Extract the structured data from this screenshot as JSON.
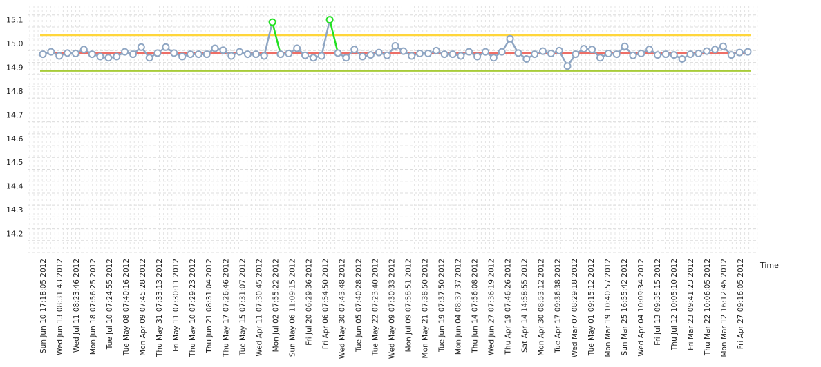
{
  "chart_data": {
    "type": "line",
    "title": "",
    "xlabel": "Time",
    "ylabel": "",
    "ylim": [
      14.12,
      15.16
    ],
    "yticks": [
      14.2,
      14.3,
      14.4,
      14.5,
      14.6,
      14.7,
      14.8,
      14.9,
      15.0,
      15.1
    ],
    "grid": true,
    "x_tick_labels": [
      "Sun Jun 10 17:18:05 2012",
      "Wed Jun 13 08:31:43 2012",
      "Wed Jul 11 08:23:46 2012",
      "Mon Jun 18 07:56:25 2012",
      "Tue Jul 10 07:24:55 2012",
      "Tue May 08 07:40:16 2012",
      "Mon Apr 09 07:45:28 2012",
      "Thu May 31 07:33:13 2012",
      "Fri May 11 07:30:11 2012",
      "Thu May 10 07:29:23 2012",
      "Thu Jun 21 08:31:04 2012",
      "Thu May 17 07:26:46 2012",
      "Tue May 15 07:31:07 2012",
      "Wed Apr 11 07:30:45 2012",
      "Mon Jul 02 07:55:22 2012",
      "Sun May 06 11:09:15 2012",
      "Fri Jul 20 06:29:36 2012",
      "Fri Apr 06 07:54:50 2012",
      "Wed May 30 07:43:48 2012",
      "Tue Jun 05 07:40:28 2012",
      "Tue May 22 07:23:40 2012",
      "Wed May 09 07:30:33 2012",
      "Mon Jul 09 07:58:51 2012",
      "Mon May 21 07:38:50 2012",
      "Tue Jun 19 07:37:50 2012",
      "Mon Jun 04 08:37:37 2012",
      "Thu Jun 14 07:56:08 2012",
      "Wed Jun 27 07:36:19 2012",
      "Thu Apr 19 07:46:26 2012",
      "Sat Apr 14 14:58:55 2012",
      "Mon Apr 30 08:53:12 2012",
      "Tue Apr 17 09:36:38 2012",
      "Wed Mar 07 08:29:18 2012",
      "Tue May 01 09:15:12 2012",
      "Mon Mar 19 10:40:57 2012",
      "Sun Mar 25 16:55:42 2012",
      "Wed Apr 04 10:09:34 2012",
      "Fri Jul 13 09:35:15 2012",
      "Thu Jul 12 10:05:10 2012",
      "Fri Mar 23 09:41:23 2012",
      "Thu Mar 22 10:06:05 2012",
      "Mon Mar 12 16:12:45 2012",
      "Fri Apr 27 09:16:05 2012"
    ],
    "series": [
      {
        "values": [
          14.955,
          14.965,
          14.948,
          14.96,
          14.958,
          14.975,
          14.955,
          14.945,
          14.94,
          14.945,
          14.965,
          14.955,
          14.985,
          14.94,
          14.96,
          14.985,
          14.96,
          14.945,
          14.955,
          14.955,
          14.955,
          14.98,
          14.972,
          14.948,
          14.965,
          14.955,
          14.955,
          14.948,
          15.09,
          14.955,
          14.958,
          14.98,
          14.95,
          14.94,
          14.948,
          15.1,
          14.96,
          14.94,
          14.975,
          14.945,
          14.952,
          14.962,
          14.95,
          14.99,
          14.968,
          14.948,
          14.958,
          14.958,
          14.97,
          14.955,
          14.955,
          14.948,
          14.965,
          14.945,
          14.965,
          14.94,
          14.965,
          15.02,
          14.96,
          14.935,
          14.955,
          14.968,
          14.958,
          14.97,
          14.905,
          14.955,
          14.978,
          14.975,
          14.94,
          14.958,
          14.955,
          14.988,
          14.95,
          14.958,
          14.975,
          14.952,
          14.955,
          14.952,
          14.935,
          14.955,
          14.958,
          14.968,
          14.975,
          14.988,
          14.952,
          14.962,
          14.965
        ],
        "color": "#8fa6c3",
        "highlight_color": "#22e022",
        "highlight_indices": [
          28,
          35
        ]
      }
    ],
    "reference_lines": [
      {
        "value": 15.035,
        "color": "#ffd63a"
      },
      {
        "value": 14.96,
        "color": "#ee6e66"
      },
      {
        "value": 14.885,
        "color": "#a8cc3a"
      }
    ]
  }
}
